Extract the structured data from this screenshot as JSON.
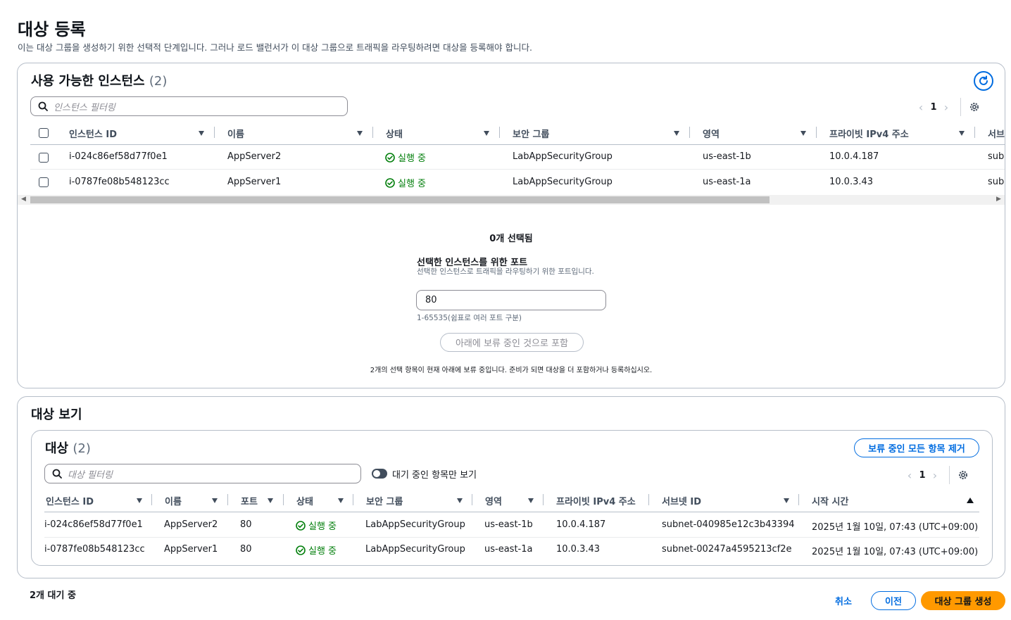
{
  "page": {
    "title": "대상 등록",
    "description": "이는 대상 그룹을 생성하기 위한 선택적 단계입니다. 그러나 로드 밸런서가 이 대상 그룹으로 트래픽을 라우팅하려면 대상을 등록해야 합니다."
  },
  "available": {
    "title": "사용 가능한 인스턴스",
    "count": "(2)",
    "filter_placeholder": "인스턴스 필터링",
    "page": "1",
    "columns": [
      "인스턴스 ID",
      "이름",
      "상태",
      "보안 그룹",
      "영역",
      "프라이빗 IPv4 주소",
      "서브"
    ],
    "rows": [
      {
        "id": "i-024c86ef58d77f0e1",
        "name": "AppServer2",
        "status": "실행 중",
        "sg": "LabAppSecurityGroup",
        "zone": "us-east-1b",
        "ip": "10.0.4.187",
        "subnet": "subn"
      },
      {
        "id": "i-0787fe08b548123cc",
        "name": "AppServer1",
        "status": "실행 중",
        "sg": "LabAppSecurityGroup",
        "zone": "us-east-1a",
        "ip": "10.0.3.43",
        "subnet": "subn"
      }
    ],
    "selected_count": "0개 선택됨",
    "port_label": "선택한 인스턴스를 위한 포트",
    "port_desc": "선택한 인스턴스로 트래픽을 라우팅하기 위한 포트입니다.",
    "port_value": "80",
    "port_hint": "1-65535(쉼표로 여러 포트 구분)",
    "include_button": "아래에 보류 중인 것으로 포함",
    "pending_note": "2개의 선택 항목이 현재 아래에 보류 중입니다. 준비가 되면 대상을 더 포함하거나 등록하십시오."
  },
  "review": {
    "title": "대상 보기",
    "targets_title": "대상",
    "targets_count": "(2)",
    "remove_button": "보류 중인 모든 항목 제거",
    "filter_placeholder": "대상 필터링",
    "toggle_label": "대기 중인 항목만 보기",
    "page": "1",
    "columns": [
      "인스턴스 ID",
      "이름",
      "포트",
      "상태",
      "보안 그룹",
      "영역",
      "프라이빗 IPv4 주소",
      "서브넷 ID",
      "시작 시간"
    ],
    "rows": [
      {
        "id": "i-024c86ef58d77f0e1",
        "name": "AppServer2",
        "port": "80",
        "status": "실행 중",
        "sg": "LabAppSecurityGroup",
        "zone": "us-east-1b",
        "ip": "10.0.4.187",
        "subnet": "subnet-040985e12c3b43394",
        "start": "2025년 1월 10일, 07:43 (UTC+09:00)"
      },
      {
        "id": "i-0787fe08b548123cc",
        "name": "AppServer1",
        "port": "80",
        "status": "실행 중",
        "sg": "LabAppSecurityGroup",
        "zone": "us-east-1a",
        "ip": "10.0.3.43",
        "subnet": "subnet-00247a4595213cf2e",
        "start": "2025년 1월 10일, 07:43 (UTC+09:00)"
      }
    ]
  },
  "footer": {
    "pending": "2개 대기 중",
    "cancel": "취소",
    "previous": "이전",
    "create": "대상 그룹 생성"
  },
  "colors": {
    "accent": "#006ce0",
    "success": "#037f0c",
    "primary_button": "#ff9900"
  }
}
